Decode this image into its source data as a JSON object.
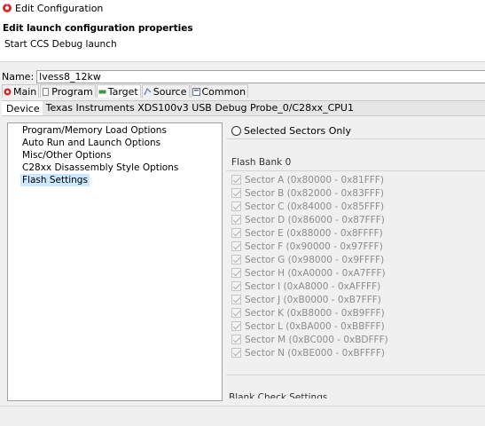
{
  "window": {
    "title": "Edit Configuration",
    "icon": "debug-config-icon"
  },
  "header": {
    "title": "Edit launch configuration properties",
    "subtitle": "Start CCS Debug launch"
  },
  "name_field": {
    "label": "Name:",
    "value": "lvess8_12kw"
  },
  "tabs": [
    {
      "label": "Main",
      "icon": "main-tab-icon",
      "active": false
    },
    {
      "label": "Program",
      "icon": "program-tab-icon",
      "active": false
    },
    {
      "label": "Target",
      "icon": "target-tab-icon",
      "active": true
    },
    {
      "label": "Source",
      "icon": "source-tab-icon",
      "active": false
    },
    {
      "label": "Common",
      "icon": "common-tab-icon",
      "active": false
    }
  ],
  "device": {
    "label": "Device",
    "value": "Texas Instruments XDS100v3 USB Debug Probe_0/C28xx_CPU1"
  },
  "categories": [
    {
      "label": "Program/Memory Load Options",
      "selected": false
    },
    {
      "label": "Auto Run and Launch Options",
      "selected": false
    },
    {
      "label": "Misc/Other Options",
      "selected": false
    },
    {
      "label": "C28xx Disassembly Style Options",
      "selected": false
    },
    {
      "label": "Flash Settings",
      "selected": true
    }
  ],
  "flash": {
    "selected_sectors_only_label": "Selected Sectors Only",
    "bank_title": "Flash Bank 0",
    "sectors": [
      "Sector A (0x80000 - 0x81FFF)",
      "Sector B (0x82000 - 0x83FFF)",
      "Sector C (0x84000 - 0x85FFF)",
      "Sector D (0x86000 - 0x87FFF)",
      "Sector E (0x88000 - 0x8FFFF)",
      "Sector F (0x90000 - 0x97FFF)",
      "Sector G (0x98000 - 0x9FFFF)",
      "Sector H (0xA0000 - 0xA7FFF)",
      "Sector I (0xA8000 - 0xAFFFF)",
      "Sector J (0xB0000 - 0xB7FFF)",
      "Sector K (0xB8000 - 0xB9FFF)",
      "Sector L (0xBA000 - 0xBBFFF)",
      "Sector M (0xBC000 - 0xBDFFF)",
      "Sector N (0xBE000 - 0xBFFFF)"
    ],
    "blank_check_title": "Blank Check Settings"
  },
  "colors": {
    "selection": "#cce8ff",
    "disabled_text": "#8c8c8c",
    "main_icon": "#d03030",
    "target_icon": "#3a9a3a"
  }
}
